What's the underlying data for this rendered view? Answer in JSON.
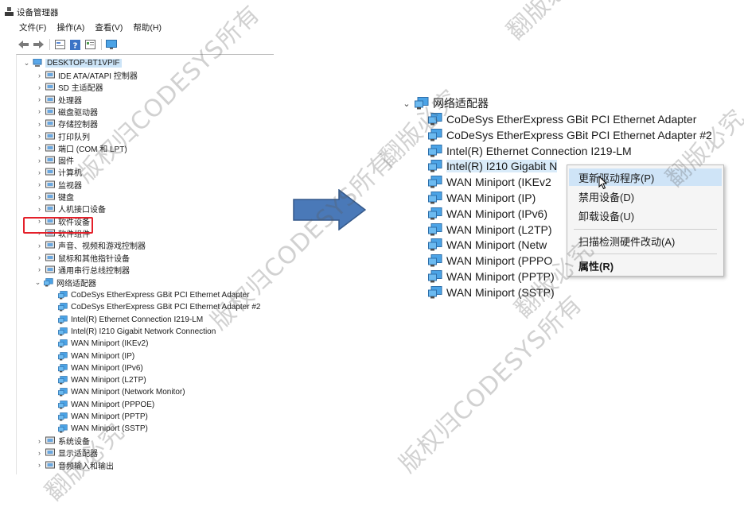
{
  "window": {
    "title": "设备管理器",
    "menu": [
      "文件(F)",
      "操作(A)",
      "查看(V)",
      "帮助(H)"
    ],
    "toolbar_icons": [
      "back-icon",
      "forward-icon",
      "properties-icon",
      "help-icon",
      "details-icon",
      "monitor-icon"
    ]
  },
  "tree": {
    "root": "DESKTOP-BT1VPIF",
    "categories": [
      {
        "label": "IDE ATA/ATAPI 控制器",
        "icon": "ide-controller-icon"
      },
      {
        "label": "SD 主适配器",
        "icon": "sd-host-icon"
      },
      {
        "label": "处理器",
        "icon": "processor-icon"
      },
      {
        "label": "磁盘驱动器",
        "icon": "disk-drive-icon"
      },
      {
        "label": "存储控制器",
        "icon": "storage-controller-icon"
      },
      {
        "label": "打印队列",
        "icon": "print-queue-icon"
      },
      {
        "label": "端口 (COM 和 LPT)",
        "icon": "port-icon"
      },
      {
        "label": "固件",
        "icon": "firmware-icon"
      },
      {
        "label": "计算机",
        "icon": "computer-icon"
      },
      {
        "label": "监视器",
        "icon": "monitor-icon"
      },
      {
        "label": "键盘",
        "icon": "keyboard-icon"
      },
      {
        "label": "人机接口设备",
        "icon": "hid-icon"
      },
      {
        "label": "软件设备",
        "icon": "software-device-icon"
      },
      {
        "label": "软件组件",
        "icon": "software-component-icon"
      },
      {
        "label": "声音、视频和游戏控制器",
        "icon": "sound-icon"
      },
      {
        "label": "鼠标和其他指针设备",
        "icon": "mouse-icon"
      },
      {
        "label": "通用串行总线控制器",
        "icon": "usb-icon"
      }
    ],
    "network_category": "网络适配器",
    "network_adapters": [
      "CoDeSys EtherExpress GBit PCI Ethernet Adapter",
      "CoDeSys EtherExpress GBit PCI Ethernet Adapter #2",
      "Intel(R) Ethernet Connection I219-LM",
      "Intel(R) I210 Gigabit Network Connection",
      "WAN Miniport (IKEv2)",
      "WAN Miniport (IP)",
      "WAN Miniport (IPv6)",
      "WAN Miniport (L2TP)",
      "WAN Miniport (Network Monitor)",
      "WAN Miniport (PPPOE)",
      "WAN Miniport (PPTP)",
      "WAN Miniport (SSTP)"
    ],
    "after_categories": [
      {
        "label": "系统设备",
        "icon": "system-device-icon"
      },
      {
        "label": "显示适配器",
        "icon": "display-adapter-icon"
      },
      {
        "label": "音频输入和输出",
        "icon": "audio-io-icon"
      }
    ]
  },
  "zoom": {
    "category": "网络适配器",
    "adapters": [
      "CoDeSys EtherExpress GBit PCI Ethernet Adapter",
      "CoDeSys EtherExpress GBit PCI Ethernet Adapter #2",
      "Intel(R) Ethernet Connection I219-LM",
      "Intel(R) I210 Gigabit N",
      "WAN Miniport (IKEv2",
      "WAN Miniport (IP)",
      "WAN Miniport (IPv6)",
      "WAN Miniport (L2TP)",
      "WAN Miniport (Netw",
      "WAN Miniport (PPPO",
      "WAN Miniport (PPTP)",
      "WAN Miniport (SSTP)"
    ]
  },
  "context_menu": {
    "update_driver": "更新驱动程序(P)",
    "disable_device": "禁用设备(D)",
    "uninstall_device": "卸载设备(U)",
    "scan_hardware": "扫描检测硬件改动(A)",
    "properties": "属性(R)"
  },
  "watermarks": [
    "版权归CODESYS所有",
    "翻版必究"
  ],
  "colors": {
    "highlight_box": "#e4202a",
    "selection": "#cce4f7",
    "menu_hover": "#cfe4f7",
    "arrow": "#4a79b8"
  }
}
